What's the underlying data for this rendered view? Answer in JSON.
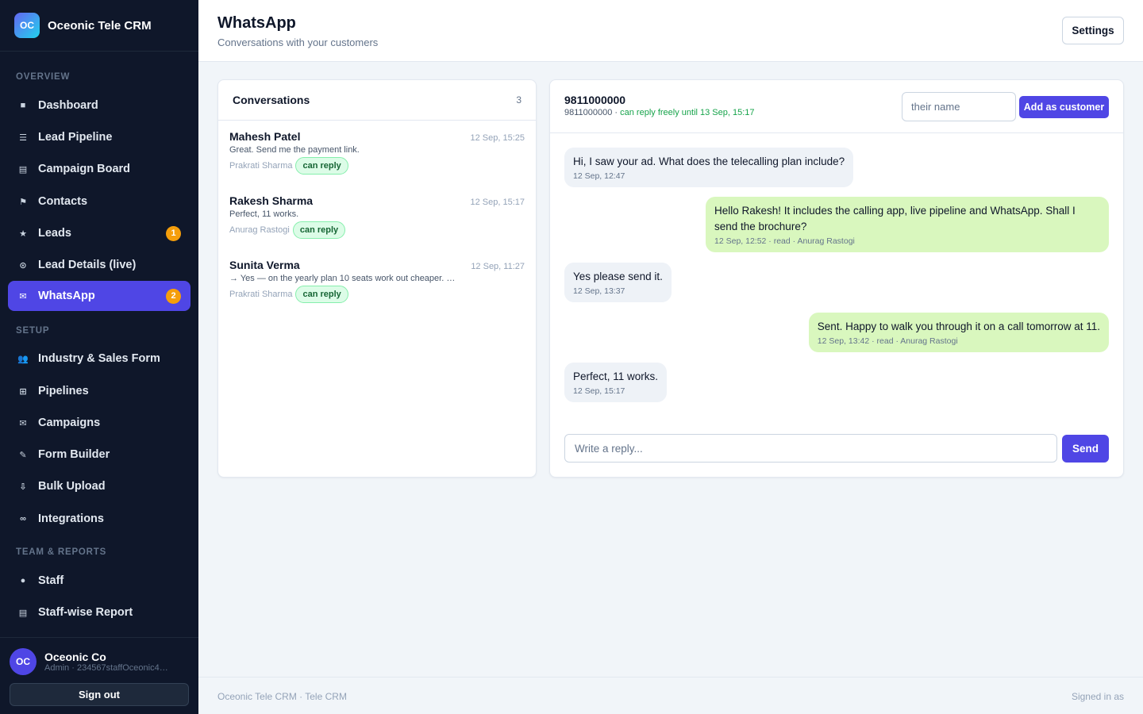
{
  "brand": {
    "logo_text": "OC",
    "name": "Oceonic Tele CRM"
  },
  "sidebar": {
    "sections": [
      {
        "label": "OVERVIEW"
      },
      {
        "label": "SETUP"
      },
      {
        "label": "TEAM & REPORTS"
      }
    ],
    "items": [
      {
        "label": "Dashboard",
        "icon": "square-icon",
        "glyph": "■"
      },
      {
        "label": "Lead Pipeline",
        "icon": "list-icon",
        "glyph": "☰"
      },
      {
        "label": "Campaign Board",
        "icon": "board-icon",
        "glyph": "▤"
      },
      {
        "label": "Contacts",
        "icon": "flag-icon",
        "glyph": "⚑"
      },
      {
        "label": "Leads",
        "icon": "star-icon",
        "glyph": "★",
        "badge": "1"
      },
      {
        "label": "Lead Details (live)",
        "icon": "target-icon",
        "glyph": "⊙"
      },
      {
        "label": "WhatsApp",
        "icon": "mail-icon",
        "glyph": "✉",
        "badge": "2",
        "active": true
      },
      {
        "label": "Industry & Sales Form",
        "icon": "people-icon",
        "glyph": "👥"
      },
      {
        "label": "Pipelines",
        "icon": "grid-icon",
        "glyph": "⊞"
      },
      {
        "label": "Campaigns",
        "icon": "envelope-icon",
        "glyph": "✉"
      },
      {
        "label": "Form Builder",
        "icon": "pen-icon",
        "glyph": "✎"
      },
      {
        "label": "Bulk Upload",
        "icon": "download-icon",
        "glyph": "⇩"
      },
      {
        "label": "Integrations",
        "icon": "link-icon",
        "glyph": "∞"
      },
      {
        "label": "Staff",
        "icon": "dot-icon",
        "glyph": "●"
      },
      {
        "label": "Staff-wise Report",
        "icon": "report-icon",
        "glyph": "▤"
      }
    ],
    "user": {
      "avatar_text": "OC",
      "name": "Oceonic Co",
      "meta": "Admin · 234567staffOceonic45…",
      "signout_label": "Sign out"
    }
  },
  "header": {
    "title": "WhatsApp",
    "subtitle": "Conversations with your customers",
    "settings_label": "Settings"
  },
  "conversations": {
    "title": "Conversations",
    "count": "3",
    "items": [
      {
        "name": "Mahesh Patel",
        "time": "12 Sep, 15:25",
        "preview": "Great. Send me the payment link.",
        "agent": "Prakrati Sharma",
        "status": "can reply"
      },
      {
        "name": "Rakesh Sharma",
        "time": "12 Sep, 15:17",
        "preview": "Perfect, 11 works.",
        "agent": "Anurag Rastogi",
        "status": "can reply"
      },
      {
        "name": "Sunita Verma",
        "time": "12 Sep, 11:27",
        "preview": "→ Yes — on the yearly plan 10 seats work out cheaper. S...",
        "agent": "Prakrati Sharma",
        "status": "can reply"
      }
    ]
  },
  "chat": {
    "number": "9811000000",
    "sub_number": "9811000000 · ",
    "sub_status": "can reply freely until 13 Sep, 15:17",
    "name_placeholder": "their name",
    "add_label": "Add as customer",
    "messages": [
      {
        "dir": "in",
        "text": "Hi, I saw your ad. What does the telecalling plan include?",
        "meta": "12 Sep, 12:47"
      },
      {
        "dir": "out",
        "text": "Hello Rakesh! It includes the calling app, live pipeline and WhatsApp. Shall I send the brochure?",
        "meta": "12 Sep, 12:52 · read · Anurag Rastogi"
      },
      {
        "dir": "in",
        "text": "Yes please send it.",
        "meta": "12 Sep, 13:37"
      },
      {
        "dir": "out",
        "text": "Sent. Happy to walk you through it on a call tomorrow at 11.",
        "meta": "12 Sep, 13:42 · read · Anurag Rastogi"
      },
      {
        "dir": "in",
        "text": "Perfect, 11 works.",
        "meta": "12 Sep, 15:17"
      }
    ],
    "reply_placeholder": "Write a reply...",
    "send_label": "Send"
  },
  "footer": {
    "left": "Oceonic Tele CRM · Tele CRM",
    "right": "Signed in as"
  }
}
